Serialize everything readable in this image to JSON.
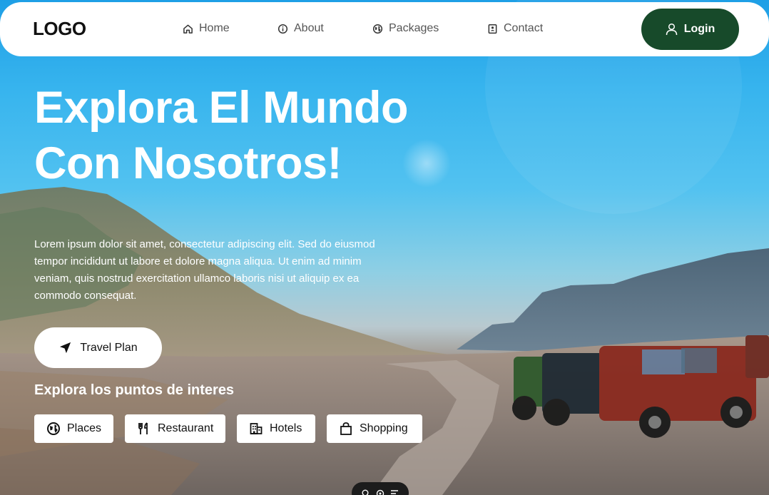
{
  "nav": {
    "logo": "LOGO",
    "items": [
      {
        "label": "Home",
        "icon": "home-icon"
      },
      {
        "label": "About",
        "icon": "info-icon"
      },
      {
        "label": "Packages",
        "icon": "globe-icon"
      },
      {
        "label": "Contact",
        "icon": "contact-book-icon"
      }
    ],
    "login_label": "Login"
  },
  "hero": {
    "headline_line1": "Explora El Mundo",
    "headline_line2": "Con Nosotros!",
    "description": "Lorem ipsum dolor sit amet, consectetur adipiscing elit. Sed do eiusmod tempor incididunt ut labore et dolore magna aliqua. Ut enim ad minim veniam, quis nostrud exercitation ullamco laboris nisi ut aliquip ex ea commodo consequat.",
    "cta_label": "Travel Plan",
    "poi_title": "Explora los puntos de interes",
    "chips": [
      {
        "label": "Places",
        "icon": "globe-icon"
      },
      {
        "label": "Restaurant",
        "icon": "fork-knife-icon"
      },
      {
        "label": "Hotels",
        "icon": "building-icon"
      },
      {
        "label": "Shopping",
        "icon": "shopping-bag-icon"
      }
    ]
  },
  "colors": {
    "login_bg": "#174a2a",
    "navbar_bg": "#ffffff",
    "text_light": "#ffffff"
  }
}
